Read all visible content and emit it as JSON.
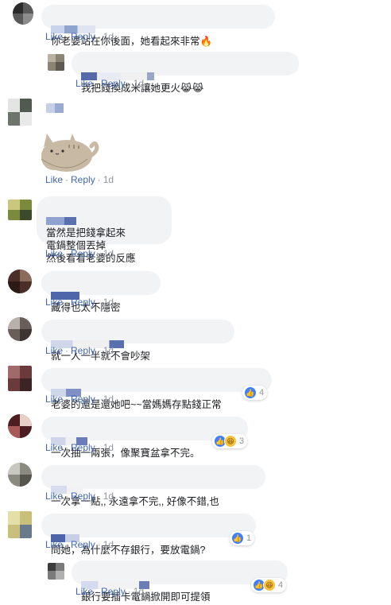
{
  "comments": [
    {
      "text": "你老婆站在你後面，她看起來非常🔥",
      "actions": {
        "like": "Like",
        "reply": "Reply",
        "time": "1d"
      }
    },
    {
      "text": "我把錢換成米讓她更火😹😹",
      "actions": {
        "like": "Like",
        "reply": "Reply",
        "time": "1d"
      }
    },
    {
      "sticker": "pusheen-cat-sticker",
      "actions": {
        "like": "Like",
        "reply": "Reply",
        "time": "1d"
      }
    },
    {
      "text": "當然是把錢拿起來\n電鍋整個丟掉\n然後看看老婆的反應",
      "actions": {
        "like": "Like",
        "reply": "Reply",
        "time": "1d"
      }
    },
    {
      "text": "藏得也太不隱密",
      "actions": {
        "like": "Like",
        "reply": "Reply",
        "time": "1d"
      }
    },
    {
      "text": "就一人一半就不會吵架",
      "actions": {
        "like": "Like",
        "reply": "Reply",
        "time": "1d"
      }
    },
    {
      "text": "老婆的還是還她吧~~當媽媽存點錢正常",
      "reactions": "4",
      "actions": {
        "like": "Like",
        "reply": "Reply",
        "time": "1d"
      }
    },
    {
      "text": "一次抽一兩張，像聚寶盆拿不完。",
      "reactions": "3",
      "actions": {
        "like": "Like",
        "reply": "Reply",
        "time": "1d"
      }
    },
    {
      "text": "一次拿一點,, 永遠拿不完,, 好像不錯,也",
      "actions": {
        "like": "Like",
        "reply": "Reply",
        "time": "1d"
      }
    },
    {
      "text": "問她，為什麼不存銀行，要放電鍋?",
      "reactions": "1",
      "actions": {
        "like": "Like",
        "reply": "Reply",
        "time": "1d"
      }
    },
    {
      "text": "銀行要插卡電鍋掀開即可提領",
      "reactions": "4",
      "actions": {
        "like": "Like",
        "reply": "Reply",
        "time": "1d"
      }
    }
  ],
  "colors": {
    "link": "#4267b2",
    "bubble": "#f2f3f5",
    "meta": "#90949c"
  }
}
